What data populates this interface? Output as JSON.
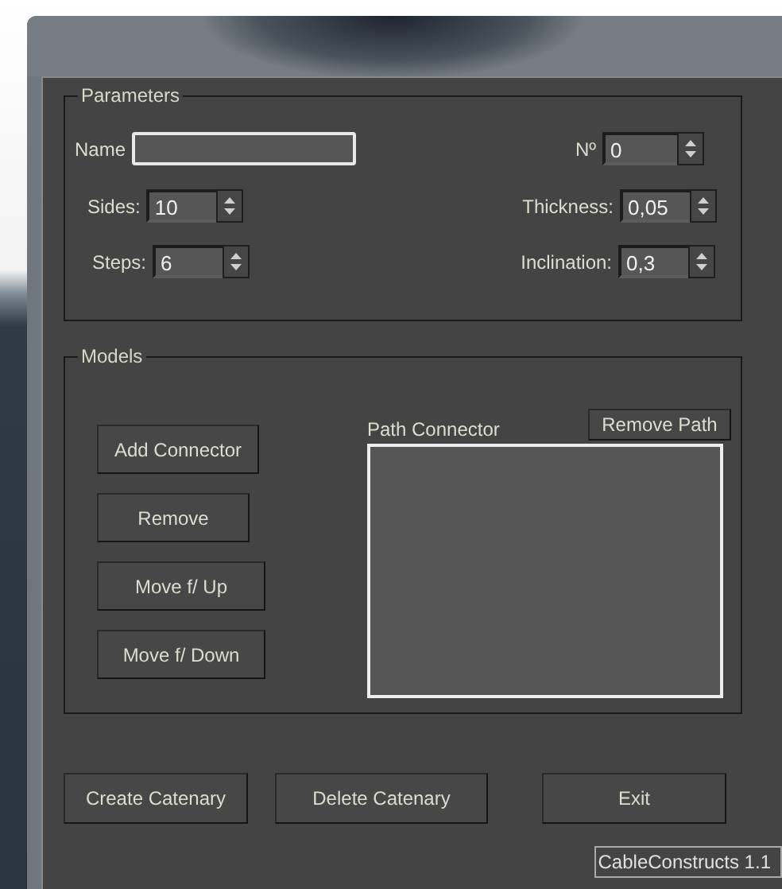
{
  "parameters": {
    "title": "Parameters",
    "name_label": "Name",
    "number": {
      "label": "Nº",
      "value": "0"
    },
    "sides": {
      "label": "Sides:",
      "value": "10"
    },
    "thickness": {
      "label": "Thickness:",
      "value": "0,05"
    },
    "steps": {
      "label": "Steps:",
      "value": "6"
    },
    "inclination": {
      "label": "Inclination:",
      "value": "0,3"
    }
  },
  "models": {
    "title": "Models",
    "buttons": [
      "Add Connector",
      "Remove",
      "Move f/ Up",
      "Move f/ Down"
    ],
    "list_label": "Path Connector",
    "remove_path_button": "Remove Path"
  },
  "footer_buttons": [
    "Create Catenary",
    "Delete Catenary",
    "Exit"
  ],
  "version": "CableConstructs 1.1"
}
